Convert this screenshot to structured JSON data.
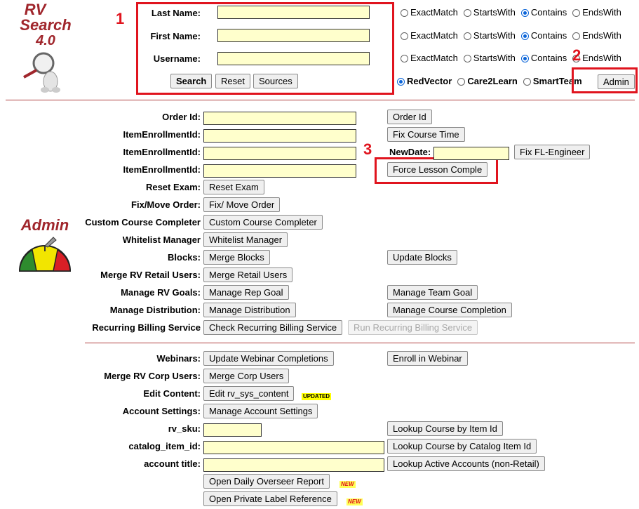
{
  "logo": {
    "line1": "RV",
    "line2": "Search",
    "line3": "4.0"
  },
  "search_form": {
    "last_name_label": "Last Name:",
    "first_name_label": "First Name:",
    "username_label": "Username:",
    "search_btn": "Search",
    "reset_btn": "Reset",
    "sources_btn": "Sources"
  },
  "match_options": [
    "ExactMatch",
    "StartsWith",
    "Contains",
    "EndsWith"
  ],
  "source_options": [
    "RedVector",
    "Care2Learn",
    "SmartTeam"
  ],
  "admin_btn": "Admin",
  "annotations": {
    "one": "1",
    "two": "2",
    "three": "3"
  },
  "admin_title": "Admin",
  "rows": {
    "order_id_label": "Order Id:",
    "order_id_btn": "Order Id",
    "item_enroll_label_1": "ItemEnrollmentId:",
    "fix_course_time_btn": "Fix Course Time",
    "item_enroll_label_2": "ItemEnrollmentId:",
    "new_date_label": "NewDate:",
    "fix_fl_btn": "Fix FL-Engineer",
    "item_enroll_label_3": "ItemEnrollmentId:",
    "force_lesson_btn": "Force Lesson Comple",
    "reset_exam_label": "Reset Exam:",
    "reset_exam_btn": "Reset Exam",
    "fix_move_label": "Fix/Move Order:",
    "fix_move_btn": "Fix/ Move Order",
    "custom_label": "Custom Course Completer",
    "custom_btn": "Custom Course Completer",
    "whitelist_label": "Whitelist Manager",
    "whitelist_btn": "Whitelist Manager",
    "blocks_label": "Blocks:",
    "merge_blocks_btn": "Merge Blocks",
    "update_blocks_btn": "Update Blocks",
    "merge_rv_label": "Merge RV Retail Users:",
    "merge_retail_btn": "Merge Retail Users",
    "goals_label": "Manage RV Goals:",
    "rep_goal_btn": "Manage Rep Goal",
    "team_goal_btn": "Manage Team Goal",
    "distribution_label": "Manage Distribution:",
    "distribution_btn": "Manage Distribution",
    "course_completion_btn": "Manage Course Completion",
    "recurring_label": "Recurring Billing Service",
    "check_recurring_btn": "Check Recurring Billing Service",
    "run_recurring_btn": "Run Recurring Billing Service",
    "webinars_label": "Webinars:",
    "update_webinar_btn": "Update Webinar Completions",
    "enroll_webinar_btn": "Enroll in Webinar",
    "merge_corp_label": "Merge RV Corp Users:",
    "merge_corp_btn": "Merge Corp Users",
    "edit_content_label": "Edit Content:",
    "edit_content_btn": "Edit rv_sys_content",
    "updated_badge": "UPDATED",
    "account_settings_label": "Account Settings:",
    "account_settings_btn": "Manage Account Settings",
    "rv_sku_label": "rv_sku:",
    "lookup_item_btn": "Lookup Course by Item Id",
    "catalog_label": "catalog_item_id:",
    "lookup_catalog_btn": "Lookup Course by Catalog Item Id",
    "account_title_label": "account title:",
    "lookup_active_btn": "Lookup Active Accounts (non-Retail)",
    "overseer_btn": "Open Daily Overseer Report",
    "new_badge_1": "NEW",
    "private_label_btn": "Open Private Label Reference",
    "new_badge_2": "NEW"
  }
}
